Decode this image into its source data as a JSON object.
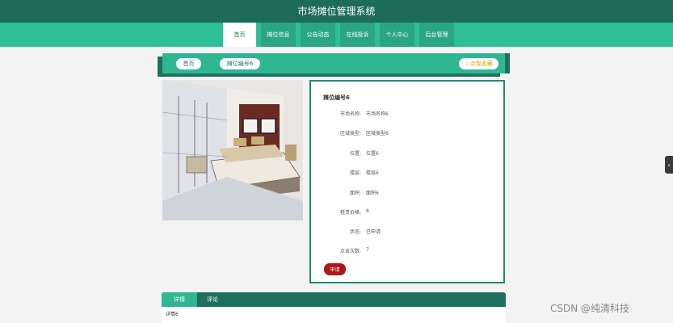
{
  "app": {
    "title": "市场摊位管理系统"
  },
  "nav": {
    "items": [
      {
        "label": "首页",
        "active": true
      },
      {
        "label": "摊位信息",
        "active": false
      },
      {
        "label": "公告动态",
        "active": false
      },
      {
        "label": "在线投诉",
        "active": false
      },
      {
        "label": "个人中心",
        "active": false
      },
      {
        "label": "后台管理",
        "active": false
      }
    ]
  },
  "breadcrumb": {
    "home": "首页",
    "current": "摊位编号6"
  },
  "favorite": {
    "icon": "star-icon",
    "label": "☆点我收藏"
  },
  "stall": {
    "title": "摊位编号6",
    "fields": [
      {
        "key": "市场名称:",
        "value": "市场名称6"
      },
      {
        "key": "区域类型:",
        "value": "区域类型6"
      },
      {
        "key": "位置:",
        "value": "位置6"
      },
      {
        "key": "楼层:",
        "value": "楼层6"
      },
      {
        "key": "面积:",
        "value": "面积6"
      },
      {
        "key": "租赁价格:",
        "value": "6"
      },
      {
        "key": "状态:",
        "value": "已申请"
      },
      {
        "key": "点击次数:",
        "value": "7"
      }
    ],
    "apply_label": "申请"
  },
  "tabs": {
    "items": [
      "详情",
      "评论"
    ],
    "active_index": 0,
    "content": "详情6"
  },
  "watermark": {
    "text": "CSDN @纯清科技"
  },
  "side_handle": {
    "icon": "chevron-left-icon",
    "glyph": "‹"
  },
  "colors": {
    "header_dark": "#1d6b59",
    "nav_green": "#2ebf99",
    "accent_dark": "#1f6f5e",
    "apply_red": "#b01616",
    "favorite_gold": "#d9a400"
  }
}
